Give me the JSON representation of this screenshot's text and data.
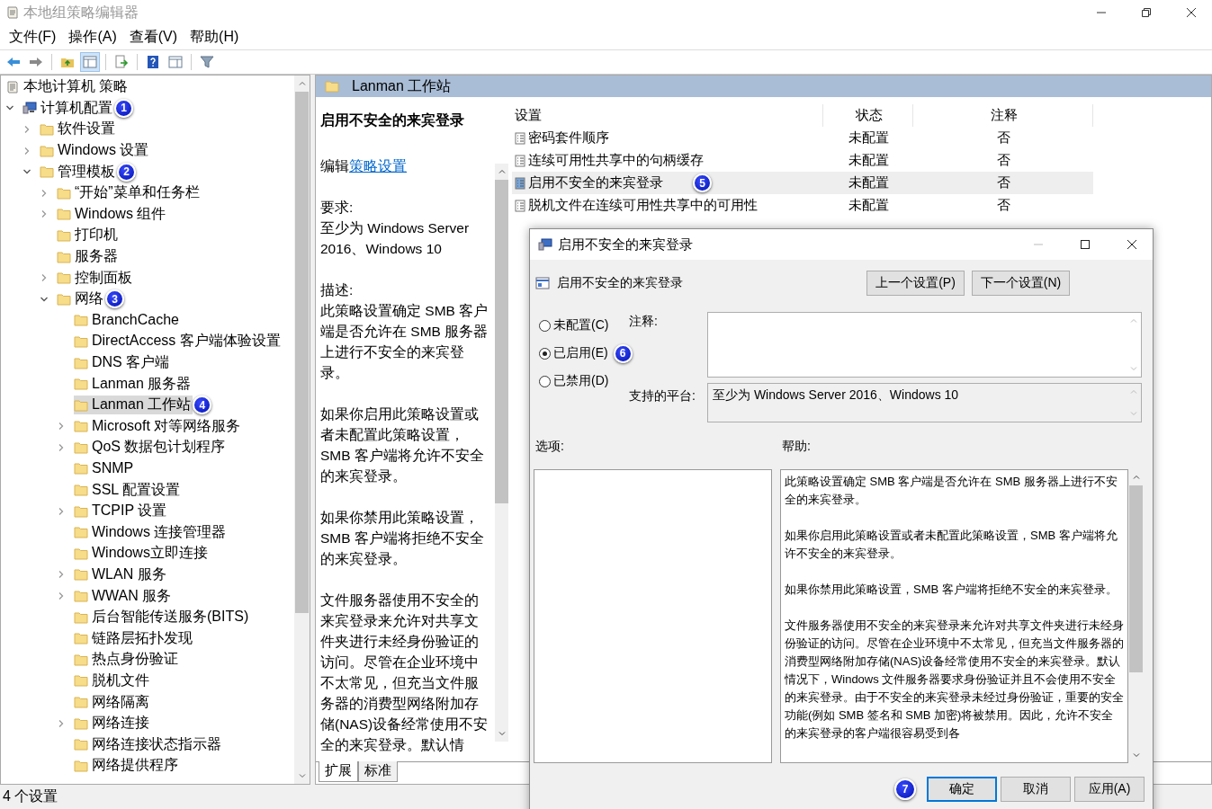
{
  "window": {
    "title": "本地组策略编辑器"
  },
  "menu": [
    "文件(F)",
    "操作(A)",
    "查看(V)",
    "帮助(H)"
  ],
  "tree": [
    {
      "label": "本地计算机 策略",
      "kind": "doc",
      "selected": false,
      "children": [
        {
          "label": "计算机配置",
          "kind": "computer",
          "expanded": true,
          "selected": false,
          "badge": "1",
          "children": [
            {
              "label": "软件设置",
              "kind": "folder",
              "expanded": false,
              "selected": false
            },
            {
              "label": "Windows 设置",
              "kind": "folder",
              "expanded": false,
              "selected": false
            },
            {
              "label": "管理模板",
              "kind": "folder",
              "expanded": true,
              "selected": false,
              "badge": "2",
              "children": [
                {
                  "label": "“开始”菜单和任务栏",
                  "kind": "folder",
                  "expanded": false,
                  "selected": false
                },
                {
                  "label": "Windows 组件",
                  "kind": "folder",
                  "expanded": false,
                  "selected": false
                },
                {
                  "label": "打印机",
                  "kind": "folder",
                  "selected": false
                },
                {
                  "label": "服务器",
                  "kind": "folder",
                  "selected": false
                },
                {
                  "label": "控制面板",
                  "kind": "folder",
                  "expanded": false,
                  "selected": false
                },
                {
                  "label": "网络",
                  "kind": "folder",
                  "expanded": true,
                  "selected": false,
                  "badge": "3",
                  "children": [
                    {
                      "label": "BranchCache",
                      "kind": "folder",
                      "selected": false
                    },
                    {
                      "label": "DirectAccess 客户端体验设置",
                      "kind": "folder",
                      "selected": false
                    },
                    {
                      "label": "DNS 客户端",
                      "kind": "folder",
                      "selected": false
                    },
                    {
                      "label": "Lanman 服务器",
                      "kind": "folder",
                      "selected": false
                    },
                    {
                      "label": "Lanman 工作站",
                      "kind": "folder",
                      "selected": true,
                      "badge": "4"
                    },
                    {
                      "label": "Microsoft 对等网络服务",
                      "kind": "folder",
                      "expanded": false,
                      "selected": false
                    },
                    {
                      "label": "QoS 数据包计划程序",
                      "kind": "folder",
                      "expanded": false,
                      "selected": false
                    },
                    {
                      "label": "SNMP",
                      "kind": "folder",
                      "selected": false
                    },
                    {
                      "label": "SSL 配置设置",
                      "kind": "folder",
                      "selected": false
                    },
                    {
                      "label": "TCPIP 设置",
                      "kind": "folder",
                      "expanded": false,
                      "selected": false
                    },
                    {
                      "label": "Windows 连接管理器",
                      "kind": "folder",
                      "selected": false
                    },
                    {
                      "label": "Windows立即连接",
                      "kind": "folder",
                      "selected": false
                    },
                    {
                      "label": "WLAN 服务",
                      "kind": "folder",
                      "expanded": false,
                      "selected": false
                    },
                    {
                      "label": "WWAN 服务",
                      "kind": "folder",
                      "expanded": false,
                      "selected": false
                    },
                    {
                      "label": "后台智能传送服务(BITS)",
                      "kind": "folder",
                      "selected": false
                    },
                    {
                      "label": "链路层拓扑发现",
                      "kind": "folder",
                      "selected": false
                    },
                    {
                      "label": "热点身份验证",
                      "kind": "folder",
                      "selected": false
                    },
                    {
                      "label": "脱机文件",
                      "kind": "folder",
                      "selected": false
                    },
                    {
                      "label": "网络隔离",
                      "kind": "folder",
                      "selected": false
                    },
                    {
                      "label": "网络连接",
                      "kind": "folder",
                      "expanded": false,
                      "selected": false
                    },
                    {
                      "label": "网络连接状态指示器",
                      "kind": "folder",
                      "selected": false
                    },
                    {
                      "label": "网络提供程序",
                      "kind": "folder",
                      "selected": false
                    }
                  ]
                }
              ]
            }
          ]
        }
      ]
    }
  ],
  "header": {
    "title": "Lanman 工作站"
  },
  "description": {
    "title": "启用不安全的来宾登录",
    "edit_prefix": "编辑",
    "edit_link": "策略设置",
    "requirement_label": "要求:",
    "requirement": "至少为 Windows Server 2016、Windows 10",
    "description_label": "描述:",
    "paragraphs": [
      "此策略设置确定 SMB 客户端是否允许在 SMB 服务器上进行不安全的来宾登录。",
      "如果你启用此策略设置或者未配置此策略设置，SMB 客户端将允许不安全的来宾登录。",
      "如果你禁用此策略设置，SMB 客户端将拒绝不安全的来宾登录。",
      "文件服务器使用不安全的来宾登录来允许对共享文件夹进行未经身份验证的访问。尽管在企业环境中不太常见，但充当文件服务器的消费型网络附加存储(NAS)设备经常使用不安全的来宾登录。默认情"
    ]
  },
  "table": {
    "columns": [
      "设置",
      "状态",
      "注释"
    ],
    "rows": [
      {
        "name": "密码套件顺序",
        "state": "未配置",
        "comment": "否",
        "selected": false
      },
      {
        "name": "连续可用性共享中的句柄缓存",
        "state": "未配置",
        "comment": "否",
        "selected": false
      },
      {
        "name": "启用不安全的来宾登录",
        "state": "未配置",
        "comment": "否",
        "selected": true,
        "badge": "5"
      },
      {
        "name": "脱机文件在连续可用性共享中的可用性",
        "state": "未配置",
        "comment": "否",
        "selected": false
      }
    ]
  },
  "view_tabs": [
    {
      "label": "扩展",
      "selected": true
    },
    {
      "label": "标准",
      "selected": false
    }
  ],
  "status_bar": "4 个设置",
  "dialog": {
    "title": "启用不安全的来宾登录",
    "setting_name": "启用不安全的来宾登录",
    "nav_buttons": [
      "上一个设置(P)",
      "下一个设置(N)"
    ],
    "options": [
      {
        "label": "未配置(C)",
        "selected": false
      },
      {
        "label": "已启用(E)",
        "selected": true,
        "badge": "6"
      },
      {
        "label": "已禁用(D)",
        "selected": false
      }
    ],
    "comment_label": "注释:",
    "platform_label": "支持的平台:",
    "platform": "至少为 Windows Server 2016、Windows 10",
    "options_label": "选项:",
    "help_label": "帮助:",
    "help": [
      "此策略设置确定 SMB 客户端是否允许在 SMB 服务器上进行不安全的来宾登录。",
      "如果你启用此策略设置或者未配置此策略设置，SMB 客户端将允许不安全的来宾登录。",
      "如果你禁用此策略设置，SMB 客户端将拒绝不安全的来宾登录。",
      "文件服务器使用不安全的来宾登录来允许对共享文件夹进行未经身份验证的访问。尽管在企业环境中不太常见，但充当文件服务器的消费型网络附加存储(NAS)设备经常使用不安全的来宾登录。默认情况下，Windows 文件服务器要求身份验证并且不会使用不安全的来宾登录。由于不安全的来宾登录未经过身份验证，重要的安全功能(例如 SMB 签名和 SMB 加密)将被禁用。因此，允许不安全的来宾登录的客户端很容易受到各"
    ],
    "buttons": [
      {
        "label": "确定",
        "kind": "default",
        "badge": "7"
      },
      {
        "label": "取消",
        "kind": "normal"
      },
      {
        "label": "应用(A)",
        "kind": "normal"
      }
    ]
  }
}
